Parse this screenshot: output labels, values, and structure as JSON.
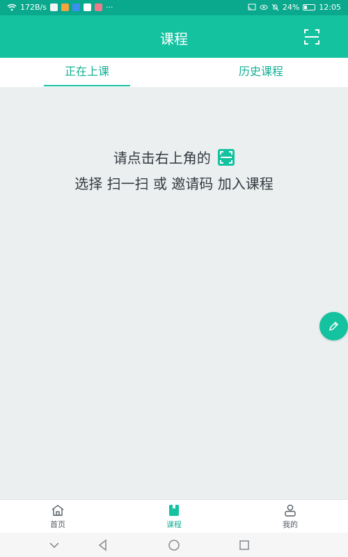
{
  "status_bar": {
    "network_speed": "172B/s",
    "more": "···",
    "battery_percent": "24%",
    "time": "12:05"
  },
  "header": {
    "title": "课程"
  },
  "tabs": [
    {
      "label": "正在上课",
      "active": true
    },
    {
      "label": "历史课程",
      "active": false
    }
  ],
  "prompt": {
    "line1": "请点击右上角的",
    "line2": "选择 扫一扫 或 邀请码 加入课程"
  },
  "bottom_nav": [
    {
      "label": "首页",
      "icon": "home-icon",
      "active": false
    },
    {
      "label": "课程",
      "icon": "course-icon",
      "active": true
    },
    {
      "label": "我的",
      "icon": "profile-icon",
      "active": false
    }
  ],
  "colors": {
    "accent": "#14c2a0",
    "status_bar": "#0aa88c",
    "background": "#eceff0"
  }
}
